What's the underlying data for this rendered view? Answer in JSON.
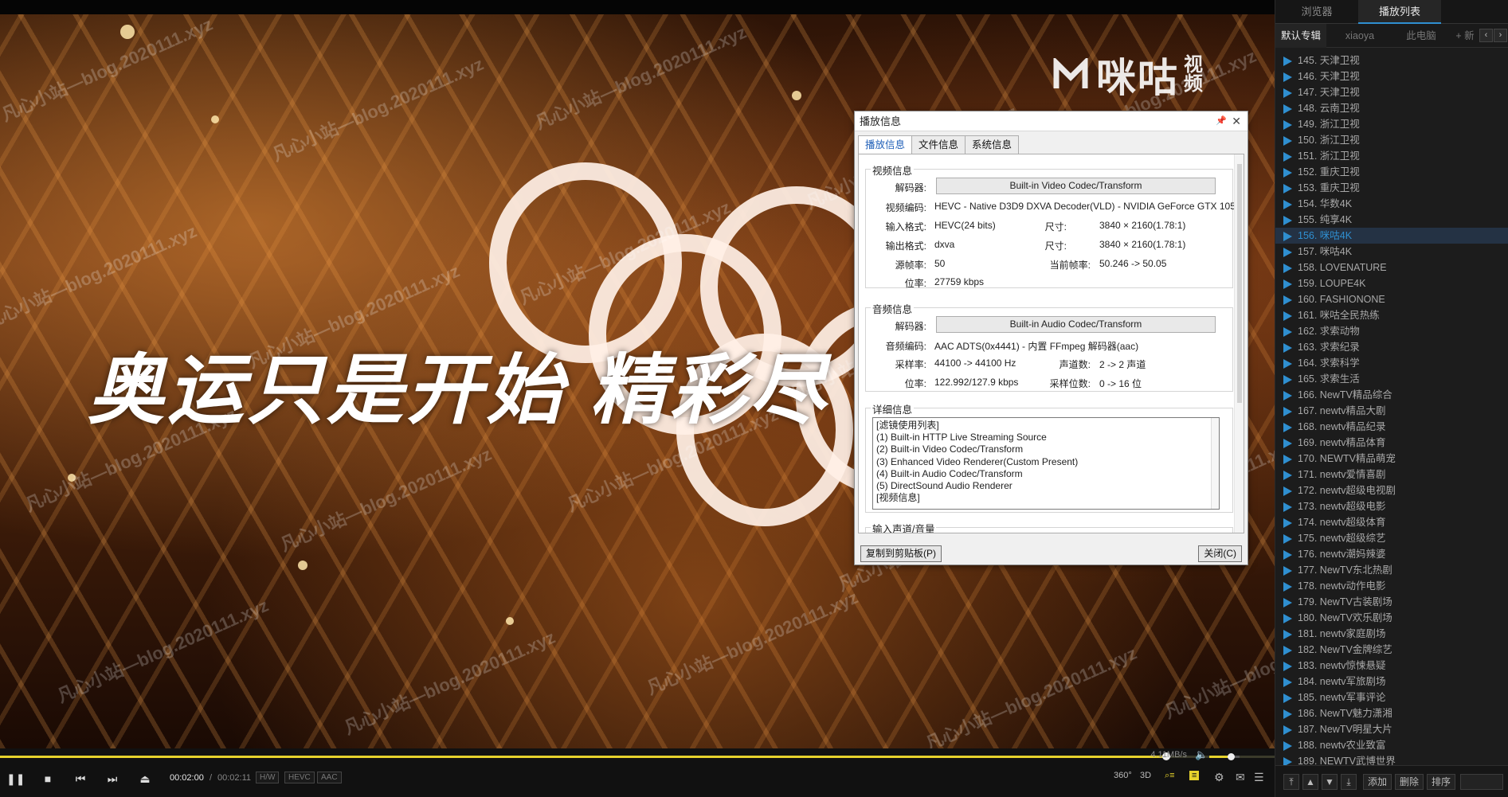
{
  "video": {
    "logo_text": "咪咕",
    "logo_sub": "视频",
    "subtitle": "奥运只是开始 精彩尽",
    "watermark": "凡心小站—blog.2020111.xyz"
  },
  "controls": {
    "time_current": "00:02:00",
    "time_separator": "/",
    "time_total": "00:02:11",
    "badges": [
      "H/W",
      "HEVC",
      "AAC"
    ],
    "net_speed": "4.11MB/s",
    "progress": 0.915,
    "volume": 0.7,
    "labels_right": [
      "360°",
      "3D"
    ],
    "accent": "#e6d22c"
  },
  "dialog": {
    "title": "播放信息",
    "tabs": [
      "播放信息",
      "文件信息",
      "系统信息"
    ],
    "video_group": "视频信息",
    "decoder_label": "解码器:",
    "video_decoder": "Built-in Video Codec/Transform",
    "video_codec_label": "视频编码:",
    "video_codec": "HEVC - Native D3D9 DXVA Decoder(VLD) - NVIDIA GeForce GTX 105",
    "input_format_label": "输入格式:",
    "input_format": "HEVC(24 bits)",
    "size_label": "尺寸:",
    "input_size": "3840 × 2160(1.78:1)",
    "output_format_label": "输出格式:",
    "output_format": "dxva",
    "output_size": "3840 × 2160(1.78:1)",
    "src_fps_label": "源帧率:",
    "src_fps": "50",
    "cur_fps_label": "当前帧率:",
    "cur_fps": "50.246 -> 50.05",
    "bitrate_label": "位率:",
    "video_bitrate": "27759 kbps",
    "audio_group": "音频信息",
    "audio_decoder": "Built-in Audio Codec/Transform",
    "audio_codec_label": "音频编码:",
    "audio_codec": "AAC ADTS(0x4441) - 内置 FFmpeg 解码器(aac)",
    "samplerate_label": "采样率:",
    "samplerate": "44100 -> 44100 Hz",
    "channels_label": "声道数:",
    "channels": "2 -> 2 声道",
    "audio_bitrate": "122.992/127.9 kbps",
    "bits_label": "采样位数:",
    "bits": "0 -> 16 位",
    "detail_group": "详细信息",
    "filters": [
      "[滤镜使用列表]",
      "  (1) Built-in HTTP Live Streaming Source",
      "  (2) Built-in Video Codec/Transform",
      "  (3) Enhanced Video Renderer(Custom Present)",
      "  (4) Built-in Audio Codec/Transform",
      "  (5) DirectSound Audio Renderer",
      "",
      "[视频信息]"
    ],
    "volume_group": "输入声道/音量",
    "copy_button": "复制到剪贴板(P)",
    "close_button": "关闭(C)"
  },
  "panel": {
    "tabs": [
      "浏览器",
      "播放列表"
    ],
    "albums": [
      "默认专辑",
      "xiaoya",
      "此电脑"
    ],
    "add_album": "+ 新",
    "items": [
      "145. 天津卫视",
      "146. 天津卫视",
      "147. 天津卫视",
      "148. 云南卫视",
      "149. 浙江卫视",
      "150. 浙江卫视",
      "151. 浙江卫视",
      "152. 重庆卫视",
      "153. 重庆卫视",
      "154. 华数4K",
      "155. 纯享4K",
      "156. 咪咕4K",
      "157. 咪咕4K",
      "158. LOVENATURE",
      "159. LOUPE4K",
      "160. FASHIONONE",
      "161. 咪咕全民热练",
      "162. 求索动物",
      "163. 求索纪录",
      "164. 求索科学",
      "165. 求索生活",
      "166. NewTV精品综合",
      "167. newtv精品大剧",
      "168. newtv精品纪录",
      "169. newtv精品体育",
      "170. NEWTV精品萌宠",
      "171. newtv爱情喜剧",
      "172. newtv超级电视剧",
      "173. newtv超级电影",
      "174. newtv超级体育",
      "175. newtv超级综艺",
      "176. newtv潮妈辣婆",
      "177. NewTV东北热剧",
      "178. newtv动作电影",
      "179. NewTV古装剧场",
      "180. NewTV欢乐剧场",
      "181. newtv家庭剧场",
      "182. NewTV金牌综艺",
      "183. newtv惊悚悬疑",
      "184. newtv军旅剧场",
      "185. newtv军事评论",
      "186. NewTV魅力潇湘",
      "187. NewTV明星大片",
      "188. newtv农业致富",
      "189. NEWTV武博世界"
    ],
    "active_index": 11,
    "bottom_buttons": [
      "添加",
      "删除",
      "排序"
    ]
  }
}
